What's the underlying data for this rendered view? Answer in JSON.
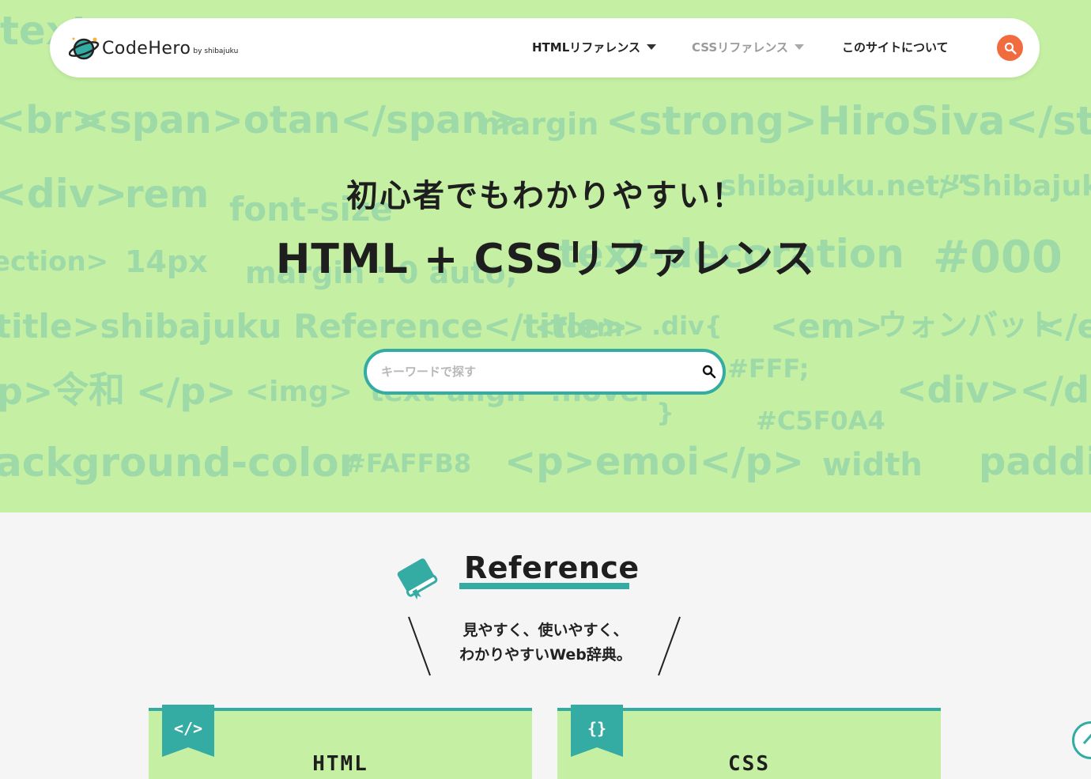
{
  "header": {
    "logo_text": "CodeHero",
    "logo_by": "by shibajuku",
    "nav": [
      {
        "label": "HTMLリファレンス"
      },
      {
        "label": "CSSリファレンス"
      },
      {
        "label": "このサイトについて"
      }
    ]
  },
  "hero": {
    "subtitle": "初心者でもわかりやすい！",
    "title": "HTML + CSSリファレンス",
    "search_placeholder": "キーワードで探す",
    "bg_code": [
      "text",
      "<br>",
      "<span>otan</span>",
      "margin",
      "<strong>HiroSiva</stro",
      "<div>",
      "rem",
      "font-size",
      "shibajuku.net/”",
      ">Shibajuku",
      "ection>",
      "14px",
      "margin : 0 auto;",
      "text-decoration",
      "#000",
      "title>shibajuku Reference</title>",
      "<form>",
      ".div{",
      "<em>",
      "ウォンバット",
      "</e",
      "p>",
      "令和",
      "</p>",
      "<img>",
      "text-align",
      ":hover",
      "#FFF;",
      "<div></div",
      "}",
      "#C5F0A4",
      "ackground-color",
      "#FAFFB8",
      "<p>emoi</p>",
      "width",
      "paddi"
    ]
  },
  "reference": {
    "heading": "Reference",
    "tagline_1": "見やすく、使いやすく、",
    "tagline_2": "わかりやすいWeb辞典。",
    "cards": [
      {
        "icon": "</>",
        "title": "HTML"
      },
      {
        "icon": "{}",
        "title": "CSS"
      }
    ]
  },
  "colors": {
    "hero_bg": "#c5f0a4",
    "accent": "#35aca3",
    "search_button": "#f26b3f",
    "bg_code_text": "#9ed9a8"
  }
}
